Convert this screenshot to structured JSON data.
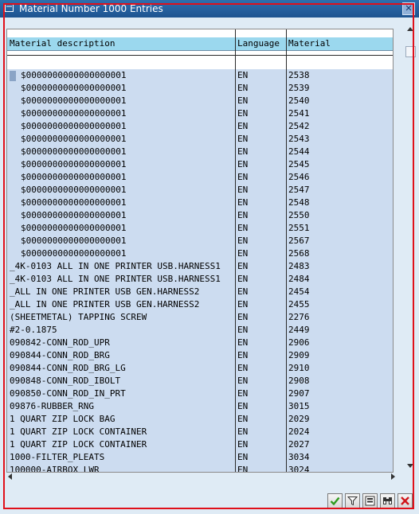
{
  "window": {
    "title": "Material Number 1000 Entries",
    "close_label": "✕"
  },
  "table": {
    "headers": {
      "description": "Material description",
      "language": "Language",
      "material": "Material"
    },
    "rows": [
      {
        "description": "$0000000000000000001",
        "language": "EN",
        "material": "2538"
      },
      {
        "description": "$0000000000000000001",
        "language": "EN",
        "material": "2539"
      },
      {
        "description": "$0000000000000000001",
        "language": "EN",
        "material": "2540"
      },
      {
        "description": "$0000000000000000001",
        "language": "EN",
        "material": "2541"
      },
      {
        "description": "$0000000000000000001",
        "language": "EN",
        "material": "2542"
      },
      {
        "description": "$0000000000000000001",
        "language": "EN",
        "material": "2543"
      },
      {
        "description": "$0000000000000000001",
        "language": "EN",
        "material": "2544"
      },
      {
        "description": "$0000000000000000001",
        "language": "EN",
        "material": "2545"
      },
      {
        "description": "$0000000000000000001",
        "language": "EN",
        "material": "2546"
      },
      {
        "description": "$0000000000000000001",
        "language": "EN",
        "material": "2547"
      },
      {
        "description": "$0000000000000000001",
        "language": "EN",
        "material": "2548"
      },
      {
        "description": "$0000000000000000001",
        "language": "EN",
        "material": "2550"
      },
      {
        "description": "$0000000000000000001",
        "language": "EN",
        "material": "2551"
      },
      {
        "description": "$0000000000000000001",
        "language": "EN",
        "material": "2567"
      },
      {
        "description": "$0000000000000000001",
        "language": "EN",
        "material": "2568"
      },
      {
        "description": "_4K-0103 ALL IN ONE PRINTER USB.HARNESS1",
        "language": "EN",
        "material": "2483"
      },
      {
        "description": "_4K-0103 ALL IN ONE PRINTER USB.HARNESS1",
        "language": "EN",
        "material": "2484"
      },
      {
        "description": "_ALL IN ONE PRINTER USB GEN.HARNESS2",
        "language": "EN",
        "material": "2454"
      },
      {
        "description": "_ALL IN ONE PRINTER USB GEN.HARNESS2",
        "language": "EN",
        "material": "2455"
      },
      {
        "description": "(SHEETMETAL) TAPPING SCREW",
        "language": "EN",
        "material": "2276"
      },
      {
        "description": "#2-0.1875",
        "language": "EN",
        "material": "2449"
      },
      {
        "description": "090842-CONN_ROD_UPR",
        "language": "EN",
        "material": "2906"
      },
      {
        "description": "090844-CONN_ROD_BRG",
        "language": "EN",
        "material": "2909"
      },
      {
        "description": "090844-CONN_ROD_BRG_LG",
        "language": "EN",
        "material": "2910"
      },
      {
        "description": "090848-CONN_ROD_IBOLT",
        "language": "EN",
        "material": "2908"
      },
      {
        "description": "090850-CONN_ROD_IN_PRT",
        "language": "EN",
        "material": "2907"
      },
      {
        "description": "09876-RUBBER_RNG",
        "language": "EN",
        "material": "3015"
      },
      {
        "description": "1 QUART ZIP LOCK BAG",
        "language": "EN",
        "material": "2029"
      },
      {
        "description": "1 QUART ZIP LOCK CONTAINER",
        "language": "EN",
        "material": "2024"
      },
      {
        "description": "1 QUART ZIP LOCK CONTAINER",
        "language": "EN",
        "material": "2027"
      },
      {
        "description": "1000-FILTER_PLEATS",
        "language": "EN",
        "material": "3034"
      },
      {
        "description": "100000-AIRBOX_LWR",
        "language": "EN",
        "material": "3024"
      }
    ]
  },
  "footer": {
    "buttons": [
      "continue-icon",
      "filter-icon",
      "select-icon",
      "binoculars-icon",
      "cancel-icon"
    ]
  },
  "colors": {
    "title_bar": "#1d5390",
    "header_bg": "#9bd8ee",
    "row_bg": "#ccdcf0",
    "frame_border": "#e0101a",
    "continue_green": "#2f9b1e",
    "cancel_red": "#d0161a"
  }
}
